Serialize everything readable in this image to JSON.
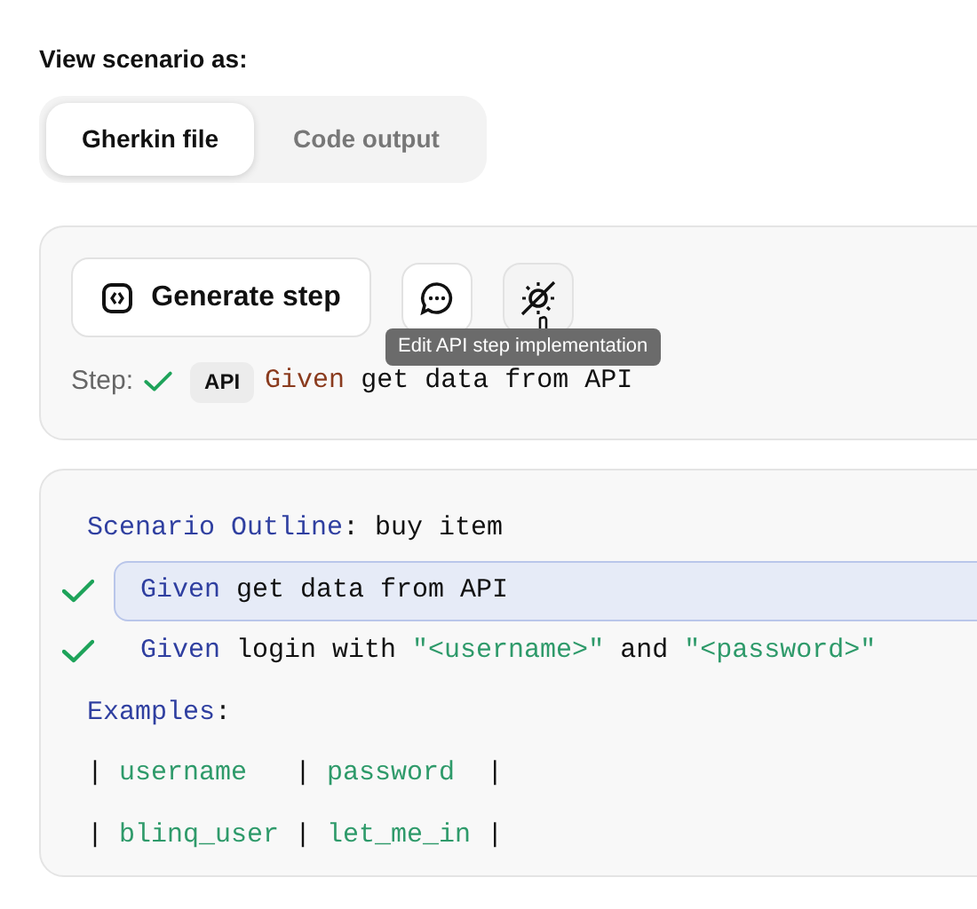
{
  "view_label": "View scenario as:",
  "view_tabs": [
    {
      "label": "Gherkin file",
      "selected": true
    },
    {
      "label": "Code output",
      "selected": false
    }
  ],
  "step_card": {
    "generate_button": "Generate step",
    "step_label": "Step:",
    "step_done": true,
    "step_badge": "API",
    "step_keyword": "Given",
    "step_text": "get data from API",
    "tooltip": "Edit API step implementation"
  },
  "scenario": {
    "lines": [
      {
        "kind": "title",
        "checked": false,
        "selected": false,
        "tokens": [
          {
            "kind": "keyword",
            "text": "Scenario Outline"
          },
          {
            "kind": "plain",
            "text": ": buy item"
          }
        ]
      },
      {
        "kind": "step",
        "checked": true,
        "selected": true,
        "tokens": [
          {
            "kind": "keyword",
            "text": "Given"
          },
          {
            "kind": "plain",
            "text": " get data from API"
          }
        ]
      },
      {
        "kind": "step",
        "checked": true,
        "selected": false,
        "tokens": [
          {
            "kind": "keyword",
            "text": "Given"
          },
          {
            "kind": "plain",
            "text": " login with "
          },
          {
            "kind": "string",
            "text": "\"<username>\""
          },
          {
            "kind": "plain",
            "text": " and "
          },
          {
            "kind": "string",
            "text": "\"<password>\""
          }
        ]
      },
      {
        "kind": "title",
        "checked": false,
        "selected": false,
        "tokens": [
          {
            "kind": "keyword",
            "text": "Examples"
          },
          {
            "kind": "plain",
            "text": ":"
          }
        ]
      },
      {
        "kind": "table",
        "checked": false,
        "selected": false,
        "tokens": [
          {
            "kind": "plain",
            "text": "| "
          },
          {
            "kind": "string",
            "text": "username  "
          },
          {
            "kind": "plain",
            "text": " | "
          },
          {
            "kind": "string",
            "text": "password"
          },
          {
            "kind": "plain",
            "text": "  |"
          }
        ]
      },
      {
        "kind": "table",
        "checked": false,
        "selected": false,
        "tokens": [
          {
            "kind": "plain",
            "text": "| "
          },
          {
            "kind": "string",
            "text": "blinq_user"
          },
          {
            "kind": "plain",
            "text": " | "
          },
          {
            "kind": "string",
            "text": "let_me_in"
          },
          {
            "kind": "plain",
            "text": " |"
          }
        ]
      }
    ]
  }
}
